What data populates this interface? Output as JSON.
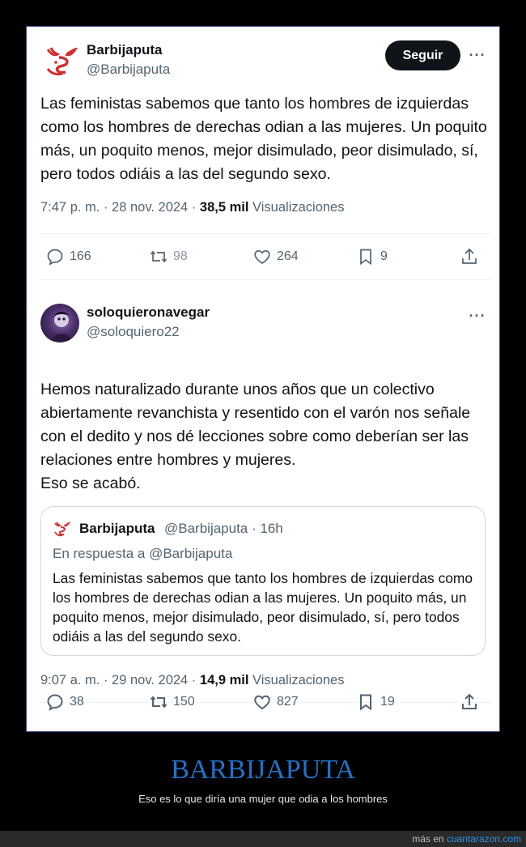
{
  "tweet1": {
    "name": "Barbijaputa",
    "handle": "@Barbijaputa",
    "follow_label": "Seguir",
    "more": "···",
    "text": "Las feministas sabemos que tanto los hombres de izquierdas como los hombres de derechas odian a las mujeres. Un poquito más, un poquito menos, mejor disimulado, peor disimulado, sí, pero todos odiáis a las del segundo sexo.",
    "time": "7:47 p. m. · 28 nov. 2024 ·",
    "views_count": "38,5 mil",
    "views_label": "Visualizaciones",
    "replies": "166",
    "retweets": "98",
    "likes": "264",
    "bookmarks": "9"
  },
  "tweet2": {
    "name": "soloquieronavegar",
    "handle": "@soloquiero22",
    "more": "···",
    "text": "Hemos naturalizado durante unos años que un colectivo abiertamente revanchista y resentido con el varón nos señale con el dedito y nos dé lecciones sobre como deberían ser las relaciones entre hombres y mujeres.\nEso se acabó.",
    "time": "9:07 a. m. · 29 nov. 2024 ·",
    "views_count": "14,9 mil",
    "views_label": "Visualizaciones",
    "replies": "38",
    "retweets": "150",
    "likes": "827",
    "bookmarks": "19",
    "quote": {
      "name": "Barbijaputa",
      "handle_time": "@Barbijaputa · 16h",
      "reply_to": "En respuesta a @Barbijaputa",
      "text": "Las feministas sabemos que tanto los hombres de izquierdas como los hombres de derechas odian a las mujeres. Un poquito más, un poquito menos, mejor disimulado, peor disimulado, sí, pero todos odiáis a las del segundo sexo."
    }
  },
  "footer": {
    "title": "BARBIJAPUTA",
    "subtitle": "Eso es lo que diría una mujer que odia a los hombres",
    "more_prefix": "más en",
    "site": "cuantarazon.com"
  },
  "colors": {
    "accent": "#1e73c8",
    "text": "#0f1419",
    "muted": "#536471",
    "logo_red": "#d32f2f"
  }
}
